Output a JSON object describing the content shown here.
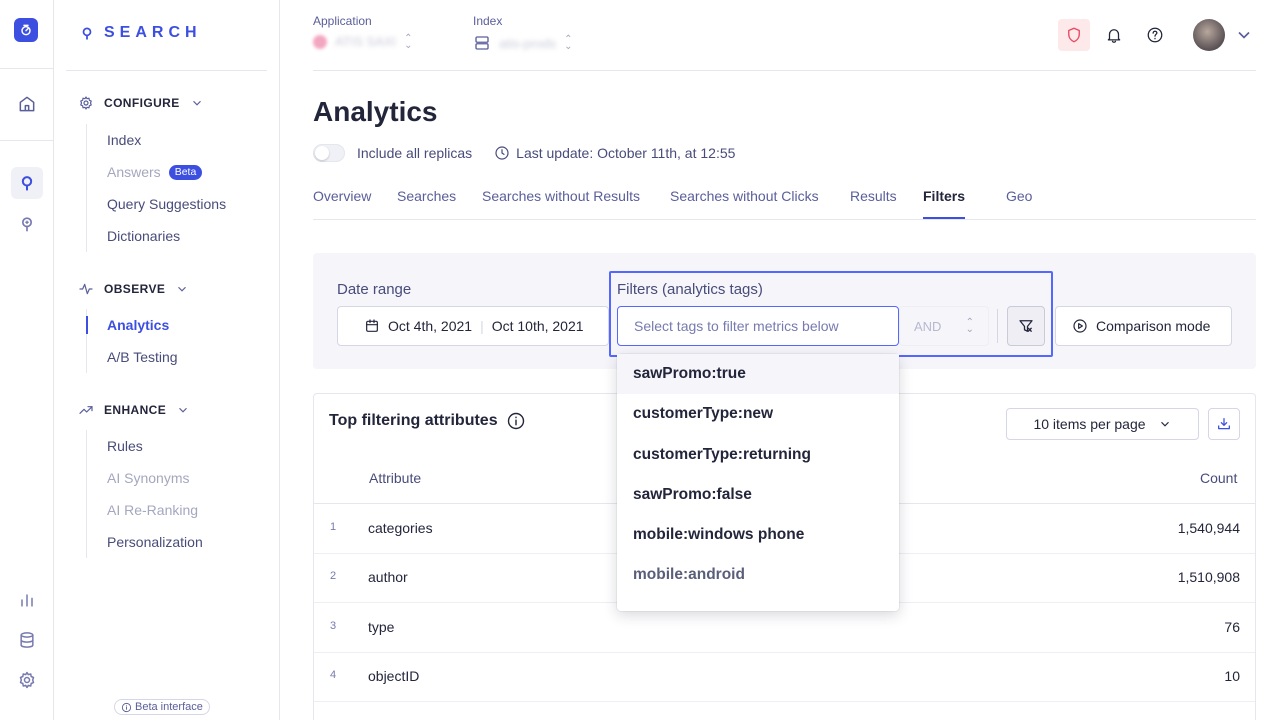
{
  "brand": {
    "name": "SEARCH"
  },
  "sidebar": {
    "configure": {
      "title": "CONFIGURE",
      "items": [
        {
          "label": "Index",
          "state": "normal"
        },
        {
          "label": "Answers",
          "state": "disabled",
          "badge": "Beta"
        },
        {
          "label": "Query Suggestions",
          "state": "normal"
        },
        {
          "label": "Dictionaries",
          "state": "normal"
        }
      ]
    },
    "observe": {
      "title": "OBSERVE",
      "items": [
        {
          "label": "Analytics",
          "state": "active"
        },
        {
          "label": "A/B Testing",
          "state": "normal"
        }
      ]
    },
    "enhance": {
      "title": "ENHANCE",
      "items": [
        {
          "label": "Rules",
          "state": "normal"
        },
        {
          "label": "AI Synonyms",
          "state": "disabled"
        },
        {
          "label": "AI Re-Ranking",
          "state": "disabled"
        },
        {
          "label": "Personalization",
          "state": "normal"
        }
      ]
    },
    "beta_interface": "Beta interface"
  },
  "header": {
    "application": {
      "label": "Application",
      "value": "ATIS SAXI"
    },
    "index": {
      "label": "Index",
      "value": "atis-prods"
    }
  },
  "page": {
    "title": "Analytics",
    "replicas_label": "Include all replicas",
    "last_update": "Last update: October 11th, at 12:55"
  },
  "tabs": [
    {
      "label": "Overview"
    },
    {
      "label": "Searches"
    },
    {
      "label": "Searches without Results"
    },
    {
      "label": "Searches without Clicks"
    },
    {
      "label": "Results"
    },
    {
      "label": "Filters",
      "active": true
    },
    {
      "label": "Geo"
    }
  ],
  "filters": {
    "date_range_label": "Date range",
    "date_start": "Oct 4th, 2021",
    "date_end": "Oct 10th, 2021",
    "tags_label": "Filters (analytics tags)",
    "tags_placeholder": "Select tags to filter metrics below",
    "operator": "AND",
    "comparison_label": "Comparison mode"
  },
  "dropdown": {
    "options": [
      "sawPromo:true",
      "customerType:new",
      "customerType:returning",
      "sawPromo:false",
      "mobile:windows phone",
      "mobile:android"
    ]
  },
  "table": {
    "title": "Top filtering attributes",
    "items_per_page": "10 items per page",
    "columns": {
      "attribute": "Attribute",
      "count": "Count"
    },
    "rows": [
      {
        "index": "1",
        "attribute": "categories",
        "count": "1,540,944"
      },
      {
        "index": "2",
        "attribute": "author",
        "count": "1,510,908"
      },
      {
        "index": "3",
        "attribute": "type",
        "count": "76"
      },
      {
        "index": "4",
        "attribute": "objectID",
        "count": "10"
      }
    ]
  },
  "colors": {
    "accent": "#3c4fe0",
    "highlight": "#5468ff",
    "text": "#23263b"
  }
}
